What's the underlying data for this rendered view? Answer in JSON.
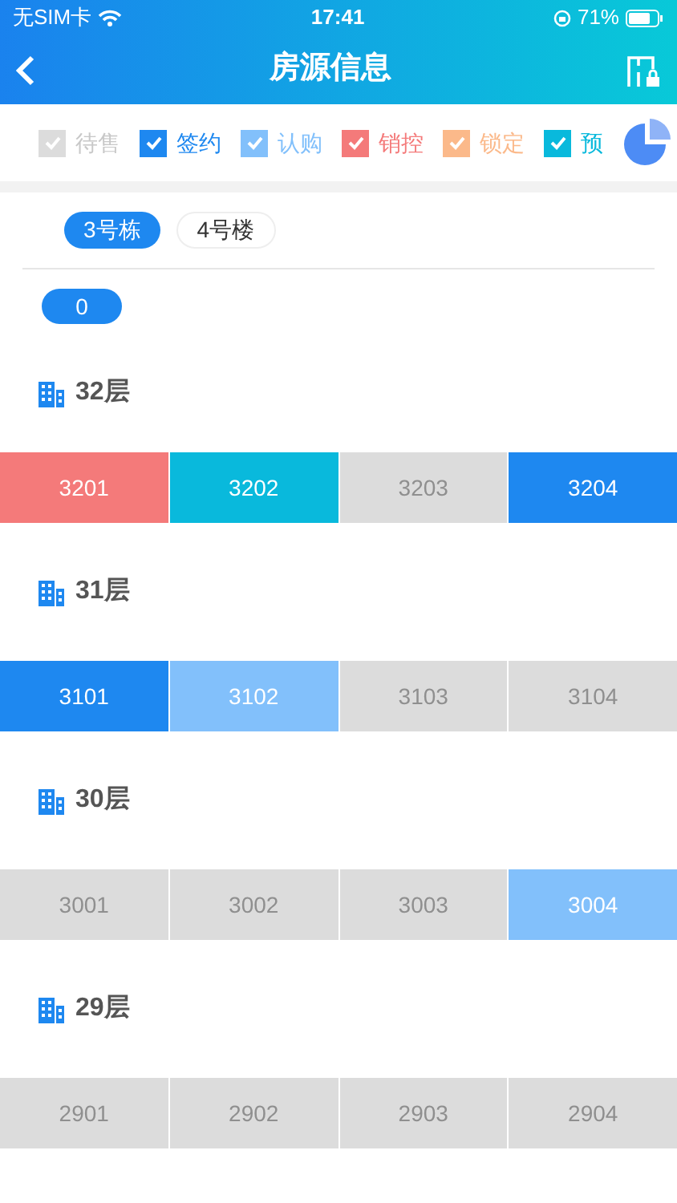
{
  "status_bar": {
    "carrier": "无SIM卡",
    "time": "17:41",
    "battery": "71%"
  },
  "header": {
    "title": "房源信息"
  },
  "legend": [
    {
      "label": "待售",
      "checked": true,
      "color": "#dcdcdc"
    },
    {
      "label": "签约",
      "checked": true,
      "color": "#1e88f0"
    },
    {
      "label": "认购",
      "checked": true,
      "color": "#82c0fb"
    },
    {
      "label": "销控",
      "checked": true,
      "color": "#f47a7a"
    },
    {
      "label": "锁定",
      "checked": true,
      "color": "#fbb98a"
    },
    {
      "label": "预",
      "checked": true,
      "color": "#09b9dc"
    }
  ],
  "buildings": [
    {
      "label": "3号栋",
      "selected": true
    },
    {
      "label": "4号楼",
      "selected": false
    }
  ],
  "units_tabs": [
    {
      "label": "0",
      "selected": true
    }
  ],
  "floors": [
    {
      "label": "32层",
      "rooms": [
        {
          "number": "3201",
          "color": "#f47a7a"
        },
        {
          "number": "3202",
          "color": "#09b9dc"
        },
        {
          "number": "3203",
          "color": "#dcdcdc"
        },
        {
          "number": "3204",
          "color": "#1e88f0"
        }
      ]
    },
    {
      "label": "31层",
      "rooms": [
        {
          "number": "3101",
          "color": "#1e88f0"
        },
        {
          "number": "3102",
          "color": "#82c0fb"
        },
        {
          "number": "3103",
          "color": "#dcdcdc"
        },
        {
          "number": "3104",
          "color": "#dcdcdc"
        }
      ]
    },
    {
      "label": "30层",
      "rooms": [
        {
          "number": "3001",
          "color": "#dcdcdc"
        },
        {
          "number": "3002",
          "color": "#dcdcdc"
        },
        {
          "number": "3003",
          "color": "#dcdcdc"
        },
        {
          "number": "3004",
          "color": "#82c0fb"
        }
      ]
    },
    {
      "label": "29层",
      "rooms": [
        {
          "number": "2901",
          "color": "#dcdcdc"
        },
        {
          "number": "2902",
          "color": "#dcdcdc"
        },
        {
          "number": "2903",
          "color": "#dcdcdc"
        },
        {
          "number": "2904",
          "color": "#dcdcdc"
        }
      ]
    }
  ]
}
